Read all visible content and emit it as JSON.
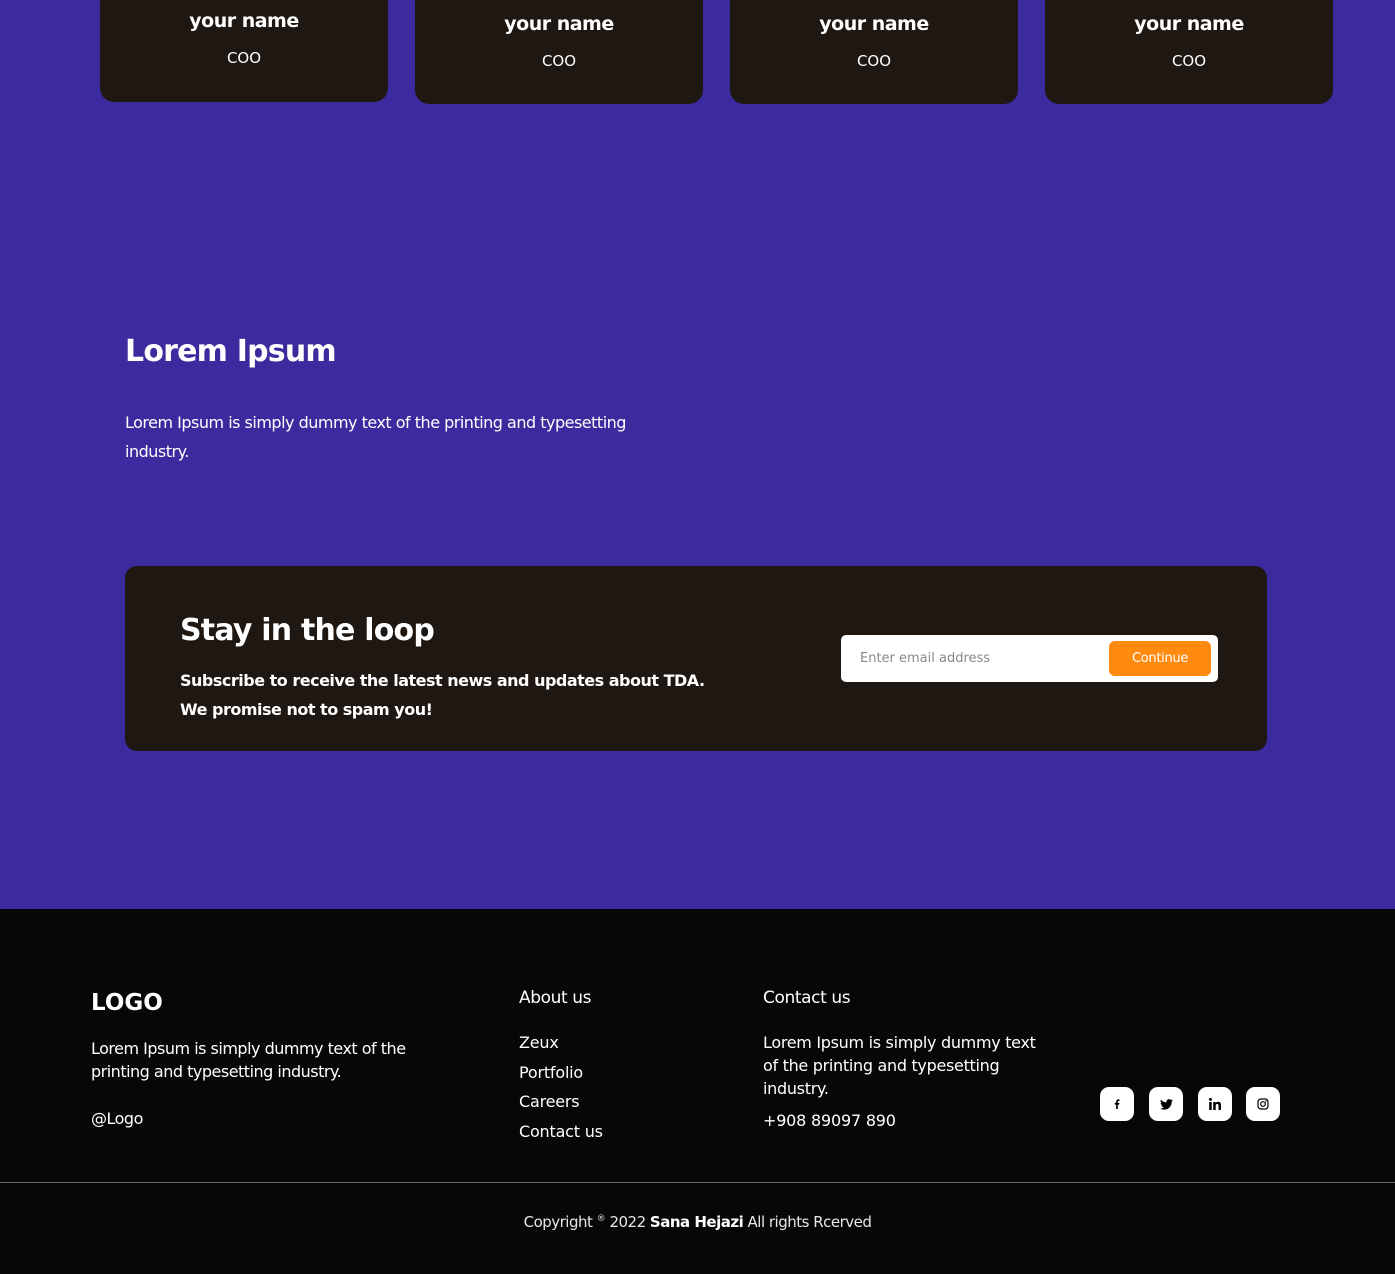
{
  "team": [
    {
      "name": "your name",
      "role": "COO"
    },
    {
      "name": "your name",
      "role": "COO"
    },
    {
      "name": "your name",
      "role": "COO"
    },
    {
      "name": "your name",
      "role": "COO"
    }
  ],
  "intro": {
    "title": "Lorem Ipsum",
    "text": "Lorem Ipsum is simply dummy text of the printing and typesetting industry."
  },
  "newsletter": {
    "title": "Stay in the loop",
    "line1": "Subscribe to receive the latest news and updates about TDA.",
    "line2": "We promise not to spam you!",
    "email_placeholder": "Enter email address",
    "email_value": "",
    "button_label": "Continue"
  },
  "footer": {
    "logo": "LOGO",
    "description": "Lorem Ipsum is simply dummy text of the printing and typesetting industry.",
    "handle": "@Logo",
    "about_title": "About us",
    "about_links": [
      "Zeux",
      "Portfolio",
      "Careers",
      "Contact us"
    ],
    "contact_title": "Contact us",
    "contact_text": "Lorem Ipsum is simply dummy text of the printing and typesetting industry.",
    "phone": "+908 89097 890",
    "social_icons": [
      "facebook-icon",
      "twitter-icon",
      "linkedin-icon",
      "instagram-icon"
    ],
    "copyright_prefix": "Copyright",
    "copyright_symbol": "®",
    "copyright_year": "2022",
    "copyright_name": "Sana Hejazi",
    "copyright_suffix": "All rights Rcerved"
  },
  "colors": {
    "page_bg": "#3c2a9f",
    "card_bg": "#1e1712",
    "footer_bg": "#070707",
    "accent": "#ff8a0d"
  }
}
